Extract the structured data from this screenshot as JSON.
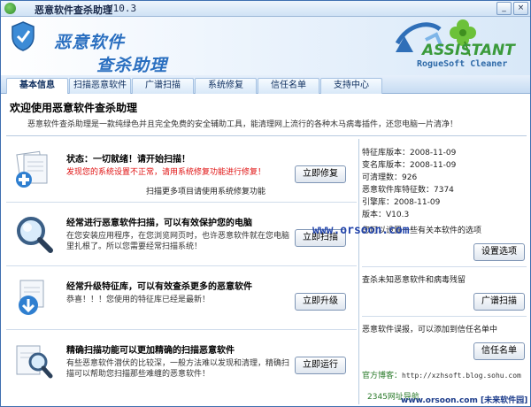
{
  "window": {
    "title": "恶意软件查杀助理",
    "version": "V10.3",
    "buttons": {
      "minimize": "_",
      "close": "×"
    }
  },
  "banner": {
    "name_line1": "恶意软件",
    "name_line2": "查杀助理",
    "logo_text": "ASSISTANT",
    "logo_sub": "RogueSoft Cleaner"
  },
  "tabs": [
    {
      "label": "基本信息",
      "active": true
    },
    {
      "label": "扫描恶意软件",
      "active": false
    },
    {
      "label": "广谱扫描",
      "active": false
    },
    {
      "label": "系统修复",
      "active": false
    },
    {
      "label": "信任名单",
      "active": false
    },
    {
      "label": "支持中心",
      "active": false
    }
  ],
  "main": {
    "title": "欢迎使用恶意软件查杀助理",
    "description": "恶意软件查杀助理是一款纯绿色并且完全免费的安全辅助工具，能清理网上流行的各种木马病毒插件，还您电脑一片清净！"
  },
  "rows": [
    {
      "title": "状态：一切就绪！请开始扫描！",
      "desc": "发现您的系统设置不正常，请用系统修复功能进行修复！",
      "sub": "扫描更多项目请使用系统修复功能",
      "button": "立即修复"
    },
    {
      "title": "经常进行恶意软件扫描，可以有效保护您的电脑",
      "desc": "在您安装应用程序，在您浏览网页时，也许恶意软件就在您电脑里扎根了。所以您需要经常扫描系统！",
      "button": "立即扫描"
    },
    {
      "title": "经常升级特征库，可以有效查杀更多的恶意软件",
      "desc": "恭喜！！！您使用的特征库已经是最新！",
      "button": "立即升级"
    },
    {
      "title": "精确扫描功能可以更加精确的扫描恶意软件",
      "desc": "有些恶意软件潜伏的比较深，一般方法难以发现和清理，精确扫描可以帮助您扫描那些难缠的恶意软件！",
      "button": "立即运行"
    }
  ],
  "info": {
    "feature_db": "特征库版本：2008-11-09",
    "rogue_db": "变名库版本：2008-11-09",
    "cleanable": "可清理数：926",
    "signatures": "恶意软件库特征数：7374",
    "engine": "引擎库：2008-11-09",
    "version": "版本：V10.3"
  },
  "right": {
    "options_text": "您可以设置一些有关本软件的选项",
    "options_button": "设置选项",
    "scan_text": "查杀未知恶意软件和病毒残留",
    "scan_button": "广谱扫描",
    "trust_text": "恶意软件误报，可以添加到信任名单中",
    "trust_button": "信任名单",
    "blog_label": "官方博客：",
    "blog_url": "http://xzhsoft.blog.sohu.com"
  },
  "footer": {
    "left": "2345网址导航",
    "right": "www.orsoon.com [未来软件园]"
  },
  "watermark": "www.orsoon.com"
}
